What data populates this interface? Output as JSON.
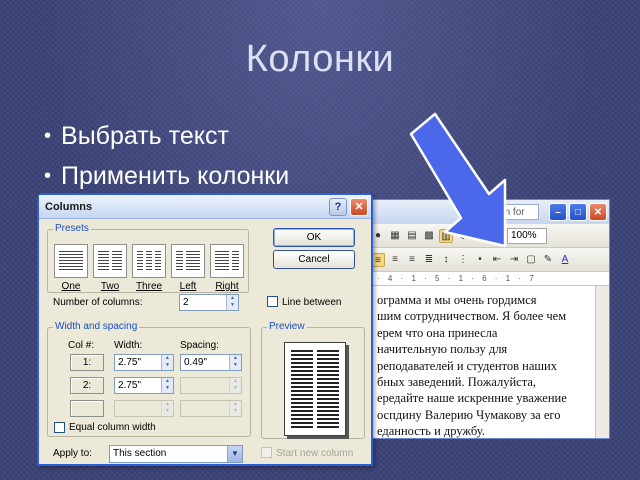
{
  "slide": {
    "title": "Колонки",
    "bullets": [
      "Выбрать текст",
      "Применить колонки"
    ]
  },
  "word": {
    "help_placeholder": "a question for help",
    "zoom": "100%",
    "ruler_text": "· 4 · 1 · 5 · 1 · 6 · 1 · 7",
    "document_lines": [
      "ограмма и мы очень гордимся",
      "шим сотрудничеством. Я более чем",
      "ерем что она принесла",
      "начительную пользу для",
      "реподавателей и студентов наших",
      "бных заведений. Пожалуйста,",
      "ередайте наше искренние уважение",
      "оспдину Валерию Чумакову за его",
      "еданность и дружбу."
    ]
  },
  "dialog": {
    "title": "Columns",
    "presets_legend": "Presets",
    "presets": [
      "One",
      "Two",
      "Three",
      "Left",
      "Right"
    ],
    "number_of_columns_label": "Number of columns:",
    "number_of_columns_value": "2",
    "line_between_label": "Line between",
    "width_spacing_legend": "Width and spacing",
    "col_header": "Col #:",
    "width_header": "Width:",
    "spacing_header": "Spacing:",
    "rows": [
      {
        "col": "1:",
        "width": "2.75\"",
        "spacing": "0.49\""
      },
      {
        "col": "2:",
        "width": "2.75\"",
        "spacing": ""
      }
    ],
    "equal_width_label": "Equal column width",
    "preview_legend": "Preview",
    "apply_to_label": "Apply to:",
    "apply_to_value": "This section",
    "start_new_column_label": "Start new column",
    "ok_label": "OK",
    "cancel_label": "Cancel"
  },
  "colors": {
    "background": "#3d4478",
    "arrow": "#4b67ea",
    "dialog_border": "#2b5fd8"
  }
}
